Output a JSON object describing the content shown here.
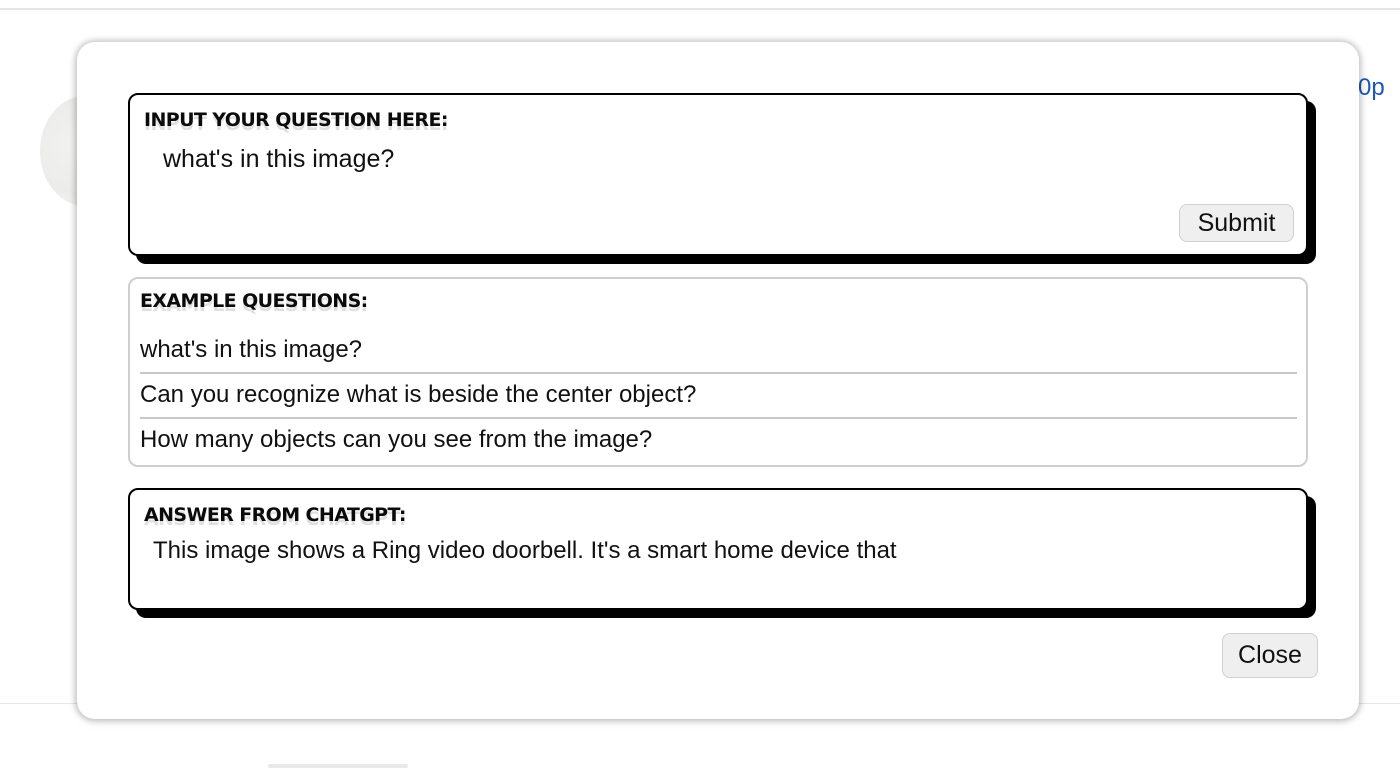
{
  "background": {
    "partial_link_text": "0p"
  },
  "question_panel": {
    "heading": "INPUT YOUR QUESTION HERE:",
    "input_value": "what's in this image?",
    "submit_label": "Submit"
  },
  "examples_panel": {
    "heading": "EXAMPLE QUESTIONS:",
    "items": [
      "what's in this image?",
      "Can you recognize what is beside the center object?",
      "How many objects can you see from the image?"
    ]
  },
  "answer_panel": {
    "heading": "ANSWER FROM CHATGPT:",
    "text": "This image shows a Ring video doorbell. It's a smart home device that"
  },
  "modal": {
    "close_label": "Close"
  },
  "colors": {
    "link_blue": "#1f58b8",
    "panel_border": "#000000",
    "light_border": "#cfcfcf",
    "button_bg": "#efefef"
  }
}
